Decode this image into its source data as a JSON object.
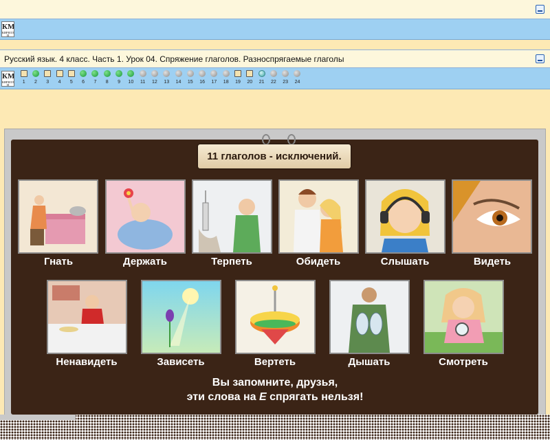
{
  "lesson_title": "Русский язык. 4 класс. Часть 1. Урок 04. Спряжение глаголов. Разноспрягаемые глаголы",
  "logo_text": "КМ",
  "steps": [
    {
      "n": "1",
      "type": "page"
    },
    {
      "n": "2",
      "type": "green"
    },
    {
      "n": "3",
      "type": "page"
    },
    {
      "n": "4",
      "type": "page"
    },
    {
      "n": "5",
      "type": "page"
    },
    {
      "n": "6",
      "type": "green"
    },
    {
      "n": "7",
      "type": "green"
    },
    {
      "n": "8",
      "type": "green"
    },
    {
      "n": "9",
      "type": "green"
    },
    {
      "n": "10",
      "type": "green"
    },
    {
      "n": "11",
      "type": "gray"
    },
    {
      "n": "12",
      "type": "gray"
    },
    {
      "n": "13",
      "type": "gray"
    },
    {
      "n": "14",
      "type": "gray"
    },
    {
      "n": "15",
      "type": "gray"
    },
    {
      "n": "16",
      "type": "gray"
    },
    {
      "n": "17",
      "type": "gray"
    },
    {
      "n": "18",
      "type": "gray"
    },
    {
      "n": "19",
      "type": "page"
    },
    {
      "n": "20",
      "type": "page"
    },
    {
      "n": "21",
      "type": "globe"
    },
    {
      "n": "22",
      "type": "gray"
    },
    {
      "n": "23",
      "type": "gray"
    },
    {
      "n": "24",
      "type": "gray"
    }
  ],
  "slide": {
    "sign": "11 глаголов - исключений.",
    "row1": [
      "Гнать",
      "Держать",
      "Терпеть",
      "Обидеть",
      "Слышать",
      "Видеть"
    ],
    "row2": [
      "Ненавидеть",
      "Зависеть",
      "Вертеть",
      "Дышать",
      "Смотреть"
    ],
    "rhyme_line1": "Вы запомните, друзья,",
    "rhyme_line2_a": "эти слова на ",
    "rhyme_line2_e": "Е",
    "rhyme_line2_b": " спрягать нельзя!"
  },
  "colors": {
    "board": "#3b2416",
    "toolbar": "#9ed0f2",
    "panel": "#fdf7dc",
    "page_bg": "#fde9b4"
  }
}
